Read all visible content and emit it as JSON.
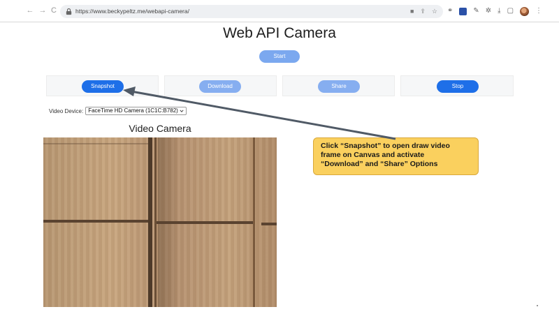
{
  "browser": {
    "url": "https://www.beckypeltz.me/webapi-camera/",
    "back_glyph": "←",
    "forward_glyph": "→",
    "reload_glyph": "C"
  },
  "page": {
    "title": "Web API Camera",
    "start_label": "Start",
    "snapshot_label": "Snapshot",
    "download_label": "Download",
    "share_label": "Share",
    "stop_label": "Stop",
    "device_label": "Video Device:",
    "device_selected": "FaceTime HD Camera (1C1C:B782)",
    "video_heading": "Video Camera"
  },
  "annotation": {
    "lines": [
      "Click “Snapshot” to open draw video",
      "frame on Canvas and activate",
      "“Download” and “Share” Options"
    ],
    "color": "#fad05e"
  },
  "colors": {
    "button_active": "#1e6fe8",
    "button_disabled": "#86aef0",
    "arrow": "#505a66"
  }
}
